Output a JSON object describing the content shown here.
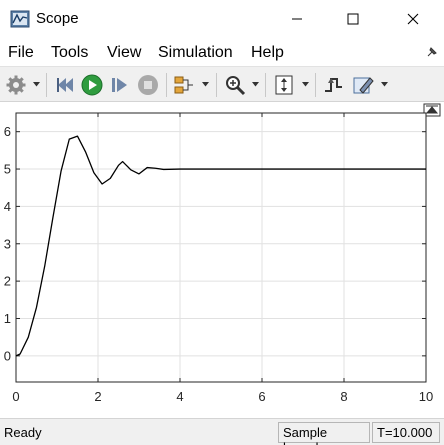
{
  "window": {
    "title": "Scope",
    "icons": {
      "app": "scope-app-icon",
      "minimize": "minimize-icon",
      "maximize": "maximize-icon",
      "close": "close-icon"
    }
  },
  "menu": {
    "items": [
      "File",
      "Tools",
      "View",
      "Simulation",
      "Help"
    ],
    "pin_icon": "pin-icon"
  },
  "toolbar": {
    "icons": [
      "settings-gear-icon",
      "step-back-icon",
      "run-icon",
      "step-forward-icon",
      "stop-icon",
      "signal-selection-icon",
      "zoom-icon",
      "autoscale-icon",
      "triggers-icon",
      "highlight-icon"
    ]
  },
  "chart_data": {
    "type": "line",
    "title": "",
    "xlabel": "",
    "ylabel": "",
    "xlim": [
      0,
      10
    ],
    "ylim": [
      -0.7,
      6.5
    ],
    "grid": true,
    "x_ticks": [
      "0",
      "2",
      "4",
      "6",
      "8",
      "10"
    ],
    "y_ticks": [
      "0",
      "1",
      "2",
      "3",
      "4",
      "5",
      "6"
    ],
    "line_color": "#000000",
    "series": [
      {
        "x": [
          0,
          0.1,
          0.3,
          0.5,
          0.7,
          0.9,
          1.1,
          1.3,
          1.5,
          1.7,
          1.9,
          2.1,
          2.3,
          2.5,
          2.6,
          2.8,
          3.0,
          3.2,
          3.4,
          3.6,
          4.0,
          5.0,
          6.0,
          7.0,
          8.0,
          9.0,
          10.0
        ],
        "values": [
          0,
          0.05,
          0.5,
          1.3,
          2.4,
          3.7,
          4.95,
          5.8,
          5.88,
          5.45,
          4.9,
          4.6,
          4.75,
          5.1,
          5.2,
          4.98,
          4.87,
          5.04,
          5.02,
          4.99,
          5.0,
          5.0,
          5.0,
          5.0,
          5.0,
          5.0,
          5.0
        ]
      }
    ]
  },
  "status": {
    "left": "Ready",
    "mode": "Sample based",
    "time": "T=10.000"
  }
}
